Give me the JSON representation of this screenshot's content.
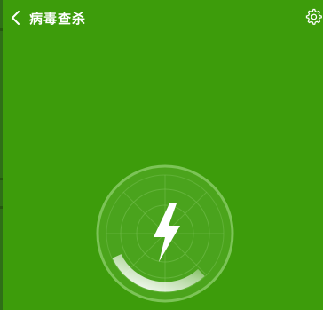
{
  "header": {
    "title": "病毒查杀",
    "back_icon": "chevron-left-icon",
    "settings_icon": "gear-icon"
  },
  "scan": {
    "status_icon": "lightning-bolt-icon",
    "progress": 0.3
  },
  "colors": {
    "background": "#3d9c0b",
    "left_edge": "#2f6f17",
    "foreground": "#ffffff"
  }
}
